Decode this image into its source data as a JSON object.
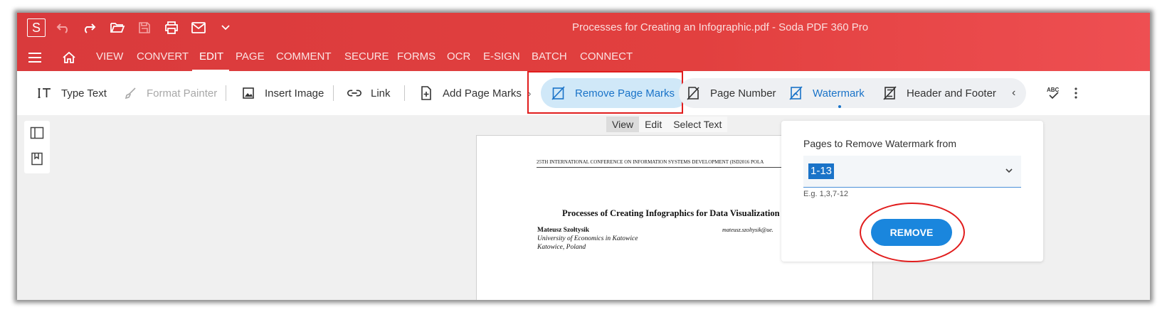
{
  "window": {
    "title": "Processes for Creating an Infographic.pdf  -  Soda PDF 360 Pro",
    "logo_letter": "S"
  },
  "menu": {
    "items": [
      "VIEW",
      "CONVERT",
      "EDIT",
      "PAGE",
      "COMMENT",
      "SECURE",
      "FORMS",
      "OCR",
      "E-SIGN",
      "BATCH",
      "CONNECT"
    ],
    "active": "EDIT"
  },
  "toolbar": {
    "type_text": "Type Text",
    "format_painter": "Format Painter",
    "insert_image": "Insert Image",
    "link": "Link",
    "add_page_marks": "Add Page Marks",
    "remove_page_marks": "Remove Page Marks",
    "page_number": "Page Number",
    "watermark": "Watermark",
    "header_footer": "Header and Footer",
    "spell_icon_text": "ABC"
  },
  "view_tabs": [
    "View",
    "Edit",
    "Select Text"
  ],
  "document": {
    "header": "25TH INTERNATIONAL CONFERENCE ON INFORMATION SYSTEMS DEVELOPMENT (ISD2016 POLA",
    "title": "Processes of Creating Infographics for Data Visualization",
    "author": "Mateusz Szołtysik",
    "affiliation1": "University of Economics in Katowice",
    "affiliation2": "Katowice, Poland",
    "email": "mateusz.szoltysik@ue."
  },
  "panel": {
    "label": "Pages to Remove Watermark from",
    "pages_value": "1-13",
    "hint": "E.g. 1,3,7-12",
    "remove_button": "REMOVE"
  },
  "colors": {
    "brand_red": "#e2403f",
    "accent_blue": "#1a73c8",
    "annotation_red": "#e11d1d"
  }
}
